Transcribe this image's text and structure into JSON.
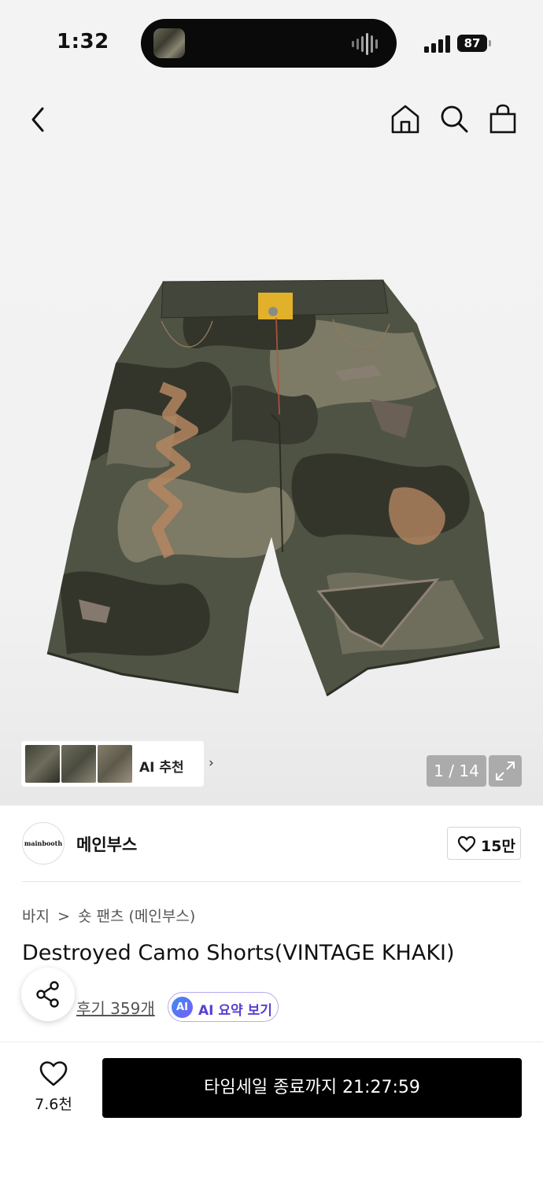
{
  "status_bar": {
    "time": "1:32",
    "battery": "87"
  },
  "nav": {
    "back_icon": "chevron-left-icon",
    "home_icon": "home-icon",
    "search_icon": "search-icon",
    "bag_icon": "shopping-bag-icon"
  },
  "gallery": {
    "counter": "1 / 14",
    "ai_recommend_label": "AI 추천",
    "product_colors": {
      "base": "#4f5344",
      "camo_dark": "#33352b",
      "camo_light": "#7d7a66",
      "stitch": "#b48660"
    }
  },
  "brand": {
    "logo_text": "mainbooth",
    "name": "메인부스",
    "like_count": "15만"
  },
  "product": {
    "breadcrumb": [
      "바지",
      ">",
      "숏 팬츠 (메인부스)"
    ],
    "title": "Destroyed Camo Shorts(VINTAGE KHAKI)",
    "review_label": "후기 359개",
    "ai_badge": "AI",
    "ai_summary_label": "AI 요약 보기"
  },
  "bottom_bar": {
    "wish_count": "7.6천",
    "buy_label": "타임세일 종료까지 21:27:59"
  }
}
